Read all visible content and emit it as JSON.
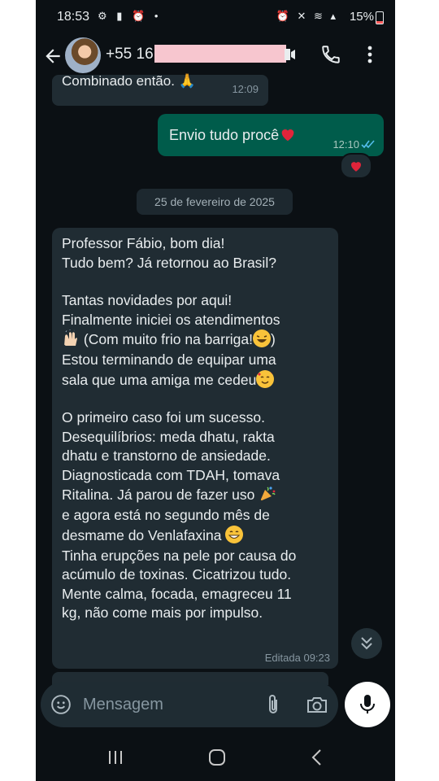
{
  "status_bar": {
    "time": "18:53",
    "battery_percent": "15%",
    "battery_level": 0.15
  },
  "header": {
    "contact_visible_text": "+55 16",
    "icons": [
      "back-arrow-icon",
      "avatar",
      "video-call-icon",
      "phone-icon",
      "more-options-icon"
    ]
  },
  "messages": [
    {
      "direction": "incoming",
      "text": "Combinado então. 🙏",
      "time": "12:09"
    },
    {
      "direction": "outgoing",
      "text": "Envio tudo procê",
      "time": "12:10",
      "reaction": "❤️",
      "read": true
    }
  ],
  "date_separator": "25 de fevereiro de 2025",
  "long_message": {
    "paragraphs": [
      [
        "Professor Fábio, bom dia!",
        "Tudo bem? Já retornou ao Brasil?"
      ],
      [
        "Tantas novidades por aqui!",
        "Finalmente iniciei os atendimentos",
        "(Com muito frio na barriga!",
        ")",
        "Estou terminando de equipar uma",
        "sala que uma amiga me cedeu"
      ],
      [
        "O primeiro caso foi um sucesso.",
        "Desequilíbrios:  meda dhatu, rakta",
        "dhatu e transtorno de ansiedade.",
        "Diagnosticada com TDAH, tomava",
        "Ritalina. Já parou de fazer uso",
        "e agora está no segundo mês de",
        "desmame do Venlafaxina",
        "Tinha erupções na pele por causa do",
        "acúmulo de toxinas. Cicatrizou tudo.",
        "Mente calma, focada, emagreceu 11",
        "kg, não come mais por impulso."
      ]
    ],
    "edited_label": "Editada 09:23"
  },
  "composer": {
    "placeholder": "Mensagem"
  },
  "colors": {
    "background": "#0b1014",
    "incoming_bubble": "#202c33",
    "outgoing_bubble": "#005c4b",
    "text": "#e9edef",
    "meta": "#8696a0",
    "read_ticks": "#53bdeb"
  }
}
